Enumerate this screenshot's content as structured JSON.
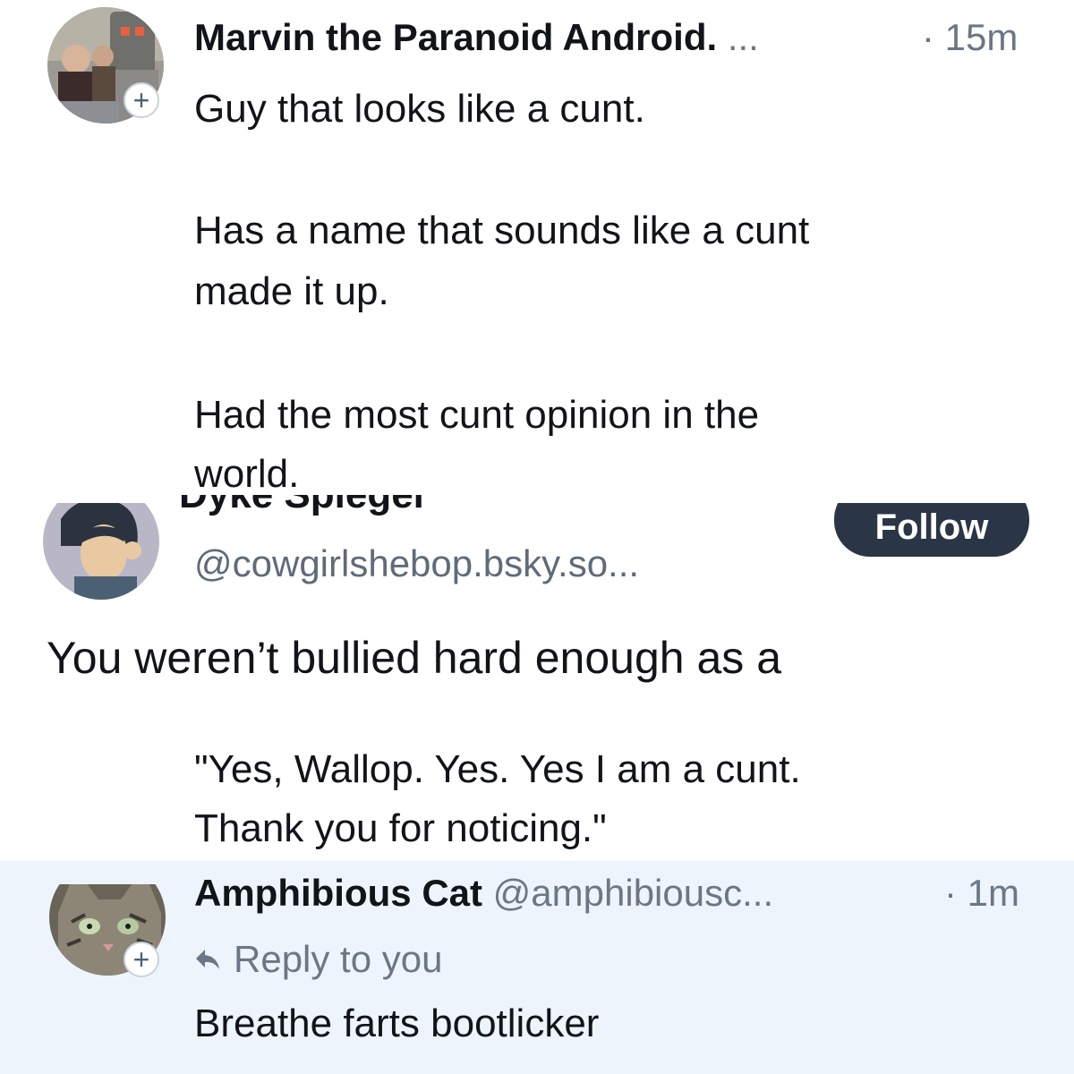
{
  "post1": {
    "display_name": "Marvin the Paranoid Android.",
    "name_ellipsis": "...",
    "time": "· 15m",
    "paragraphs": [
      "Guy that looks like a cunt.",
      "Has a name that sounds like a cunt",
      "made it up.",
      "Had the most cunt opinion in the",
      "world."
    ]
  },
  "post2": {
    "display_name_partial": "Dyke Spiegel",
    "handle": "@cowgirlshebop.bsky.so...",
    "follow_label": "Follow",
    "body": "You weren’t bullied hard enough as a"
  },
  "quote_reply": {
    "lines": [
      "\"Yes, Wallop. Yes. Yes I am a cunt.",
      "Thank you for noticing.\""
    ]
  },
  "post3": {
    "display_name": "Amphibious Cat",
    "handle": "@amphibiousc...",
    "time": "· 1m",
    "reply_label": "Reply to you",
    "body": "Breathe farts bootlicker",
    "background": "#eef4fb"
  },
  "icons": {
    "plus": "+",
    "reply_arrow": "reply-arrow-icon"
  },
  "colors": {
    "text": "#111418",
    "muted": "#6b7785",
    "follow_button": "#2a3645",
    "reply_panel": "#eef4fb"
  }
}
